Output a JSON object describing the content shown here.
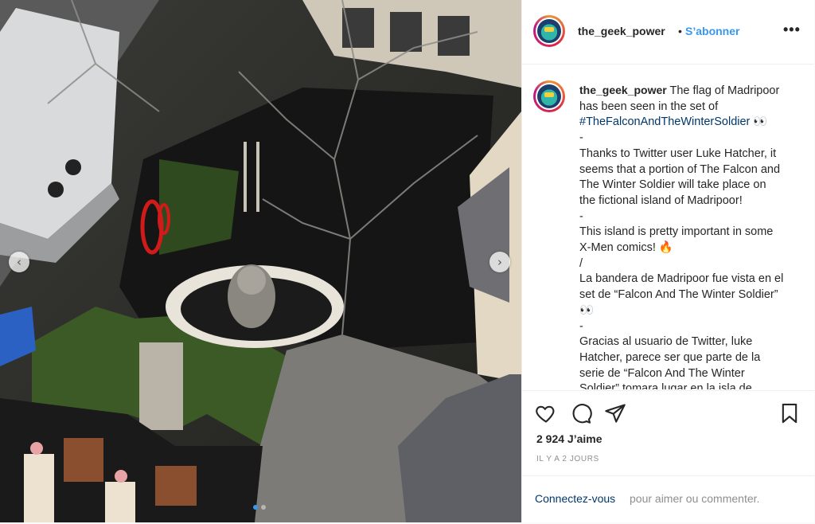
{
  "post": {
    "username": "the_geek_power",
    "separator": "•",
    "follow_label": "S’abonner",
    "more_label": "•••",
    "caption": {
      "username": "the_geek_power",
      "lines": [
        {
          "text": "The flag of Madripoor"
        },
        {
          "text": "has been seen in the set of"
        },
        {
          "text": "#TheFalconAndTheWinterSoldier",
          "suffix": " 👀"
        },
        {
          "text": "-"
        },
        {
          "text": "Thanks to Twitter user Luke Hatcher, it"
        },
        {
          "text": "seems that a portion of The Falcon and"
        },
        {
          "text": "The Winter Soldier will take place on"
        },
        {
          "text": "the fictional island of Madripoor!"
        },
        {
          "text": "-"
        },
        {
          "text": "This island is pretty important in some"
        },
        {
          "text": "X-Men comics! 🔥"
        },
        {
          "text": "/"
        },
        {
          "text": "La bandera de Madripoor fue vista en el"
        },
        {
          "text": "set de “Falcon And The Winter Soldier”"
        },
        {
          "text": "👀"
        },
        {
          "text": "-"
        },
        {
          "text": "Gracias al usuario de Twitter, luke"
        },
        {
          "text": "Hatcher, parece ser que parte de la"
        },
        {
          "text": "serie de “Falcon And The Winter"
        },
        {
          "text": "Soldier” tomara lugar en la isla de"
        }
      ]
    },
    "likes": "2 924 J’aime",
    "timestamp": "IL Y A 2 JOURS",
    "login_link": "Connectez-vous",
    "login_text": "pour aimer ou commenter.",
    "carousel": {
      "prev_icon": "‹",
      "next_icon": "›",
      "slides": 2,
      "active": 1
    }
  },
  "icons": [
    "heart-icon",
    "comment-icon",
    "share-icon",
    "bookmark-icon",
    "chevron-left-icon",
    "chevron-right-icon"
  ],
  "colors": {
    "link_blue": "#3897f0",
    "text": "#262626",
    "muted": "#8e8e8e",
    "hashtag": "#00376b"
  }
}
